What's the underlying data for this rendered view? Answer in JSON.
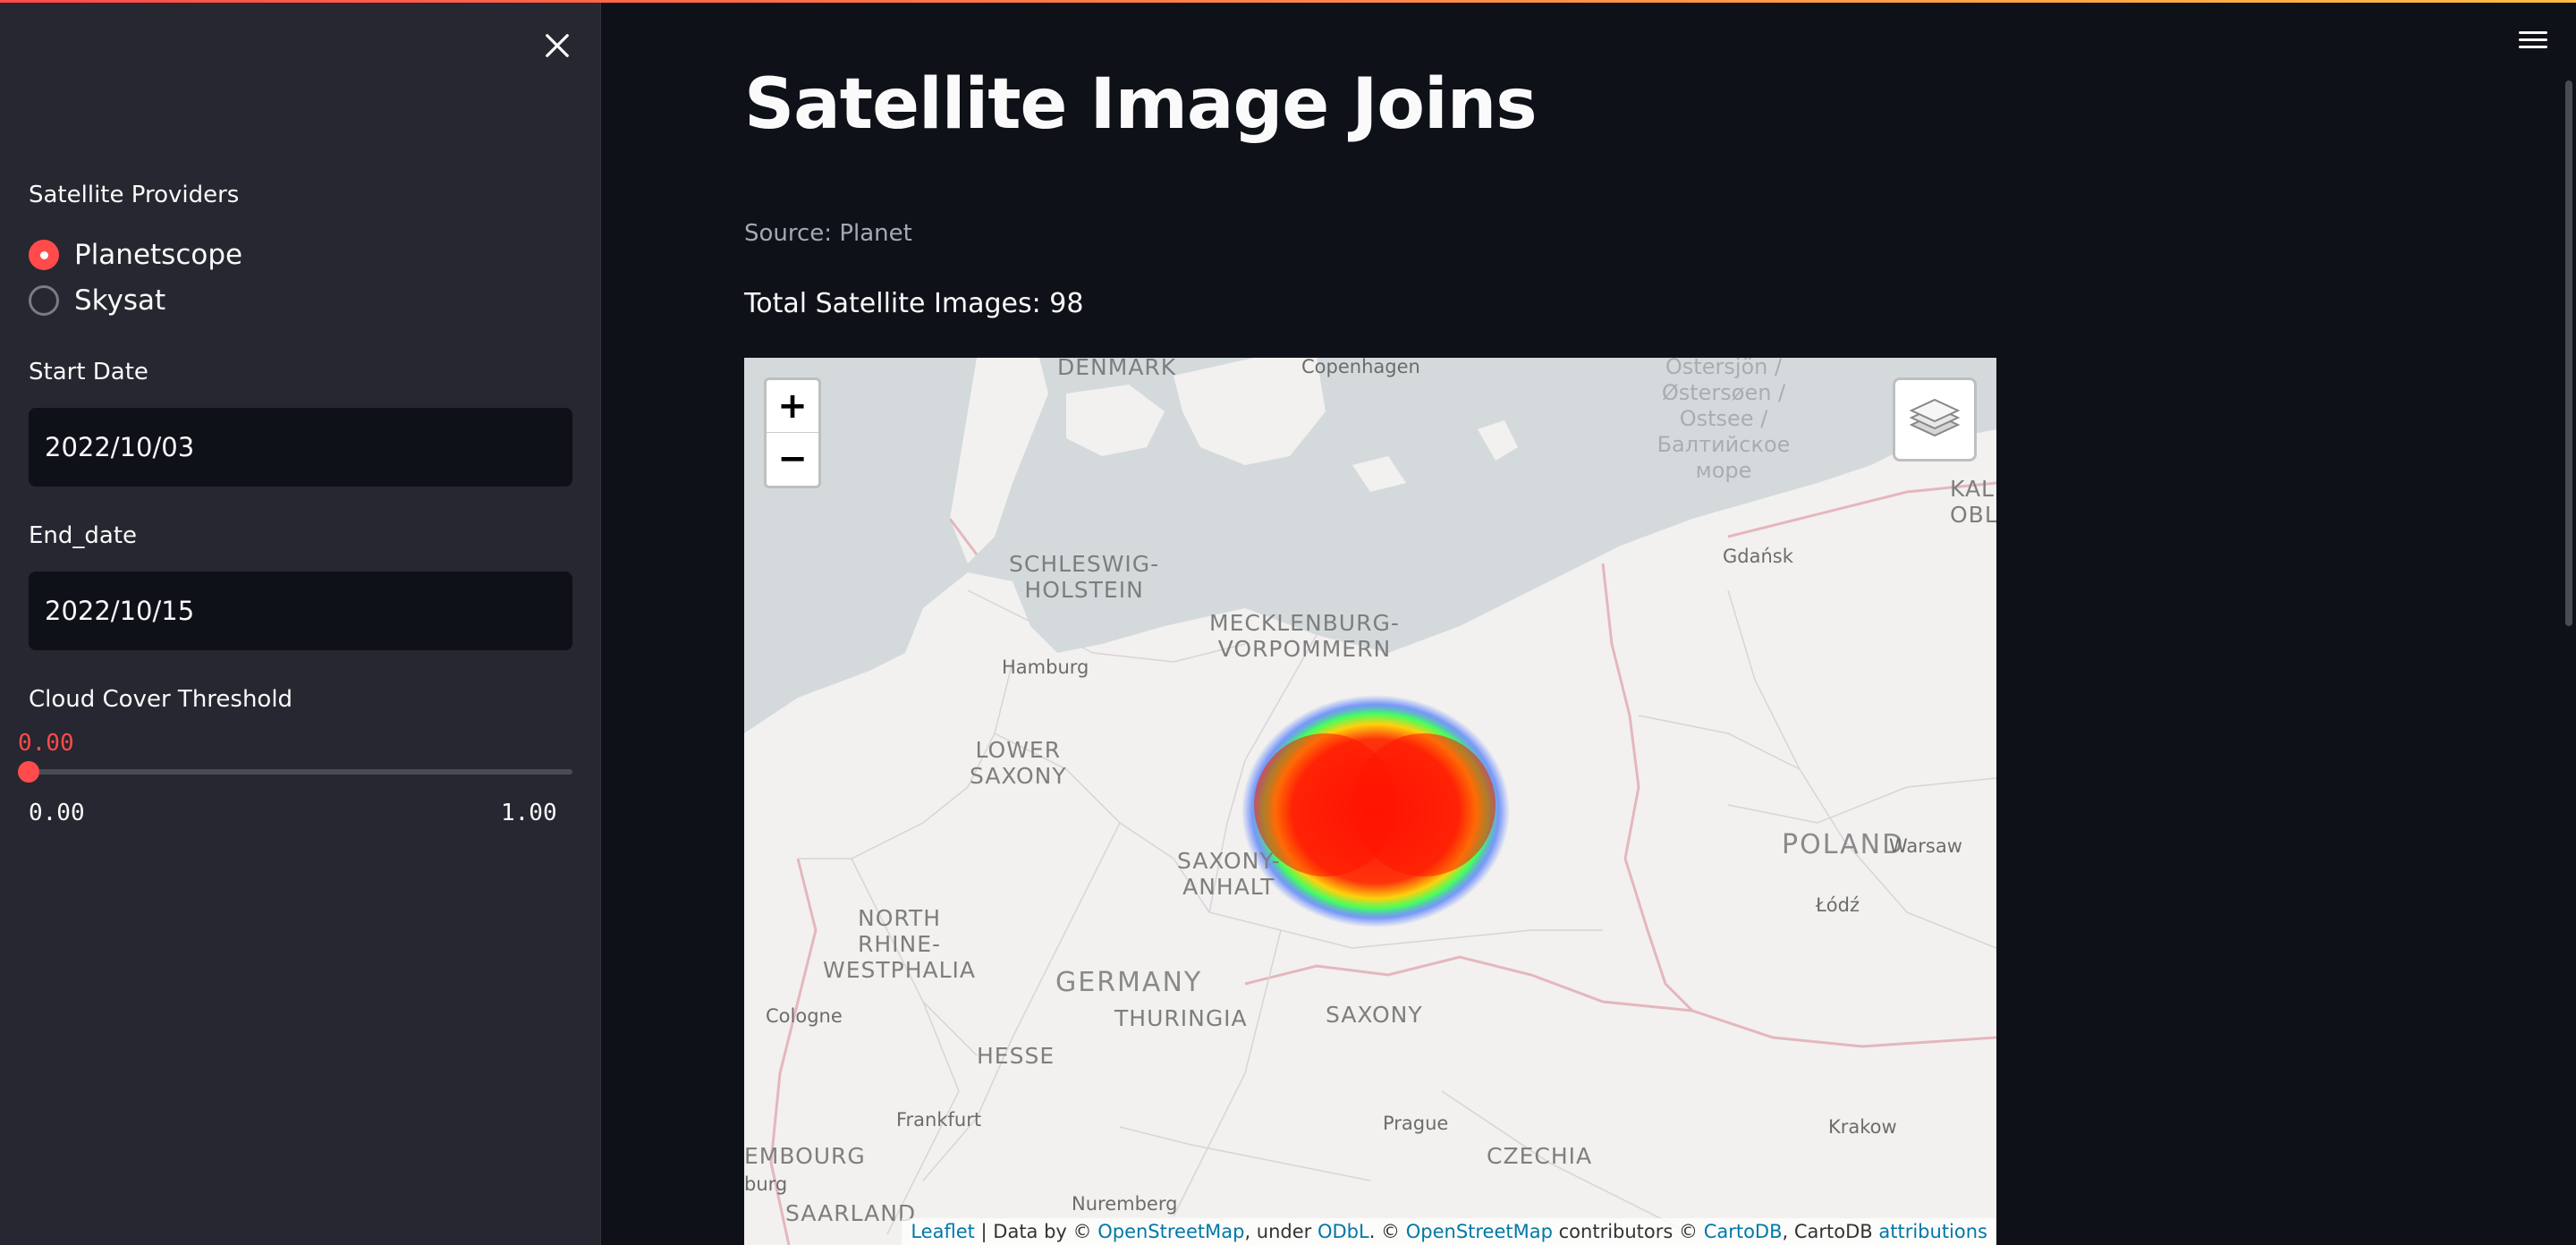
{
  "sidebar": {
    "providers_label": "Satellite Providers",
    "providers": [
      {
        "label": "Planetscope",
        "selected": true
      },
      {
        "label": "Skysat",
        "selected": false
      }
    ],
    "start_date_label": "Start Date",
    "start_date_value": "2022/10/03",
    "end_date_label": "End_date",
    "end_date_value": "2022/10/15",
    "cloud_label": "Cloud Cover Threshold",
    "cloud_value": "0.00",
    "cloud_min": "0.00",
    "cloud_max": "1.00",
    "cloud_fraction": 0.0
  },
  "main": {
    "title": "Satellite Image Joins",
    "source": "Source: Planet",
    "total": "Total Satellite Images: 98"
  },
  "map": {
    "zoom_in": "+",
    "zoom_out": "−",
    "labels": {
      "denmark": "DENMARK",
      "copenhagen": "Copenhagen",
      "baltic_1": "Östersjön /",
      "baltic_2": "Østersøen /",
      "baltic_3": "Ostsee /",
      "baltic_4": "Балтийское",
      "baltic_5": "море",
      "kalin_1": "KALINI",
      "kalin_2": "OBL",
      "schleswig_1": "SCHLESWIG-",
      "schleswig_2": "HOLSTEIN",
      "gdansk": "Gdańsk",
      "meck_1": "MECKLENBURG-",
      "meck_2": "VORPOMMERN",
      "hamburg": "Hamburg",
      "lower_1": "LOWER",
      "lower_2": "SAXONY",
      "poland": "POLAND",
      "warsaw": "Warsaw",
      "saxony_anhalt_1": "SAXONY-",
      "saxony_anhalt_2": "ANHALT",
      "lodz": "Łódź",
      "nrw_1": "NORTH",
      "nrw_2": "RHINE-",
      "nrw_3": "WESTPHALIA",
      "germany": "GERMANY",
      "thuringia": "THURINGIA",
      "saxony": "SAXONY",
      "cologne": "Cologne",
      "hesse": "HESSE",
      "frankfurt": "Frankfurt",
      "prague": "Prague",
      "krakow": "Krakow",
      "luxembourg": "EMBOURG",
      "burg": "burg",
      "czechia": "CZECHIA",
      "nuremberg": "Nuremberg",
      "saarland": "SAARLAND"
    },
    "attribution": {
      "leaflet": "Leaflet",
      "t1": " | Data by © ",
      "osm1": "OpenStreetMap",
      "t2": ", under ",
      "odbl": "ODbL",
      "t3": ". © ",
      "osm2": "OpenStreetMap",
      "t4": " contributors © ",
      "cartodb": "CartoDB",
      "t5": ", CartoDB ",
      "attributions": "attributions"
    }
  },
  "colors": {
    "accent": "#ff4b4b",
    "sidebar_bg": "#262730",
    "main_bg": "#0e1117"
  }
}
